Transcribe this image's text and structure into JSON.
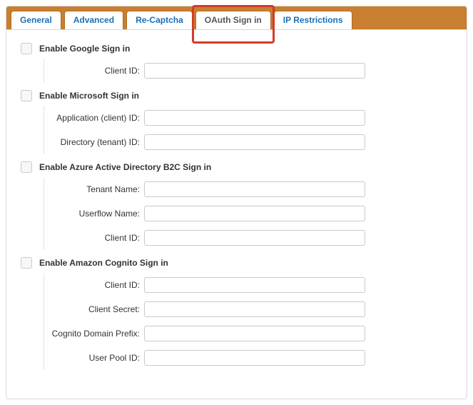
{
  "tabs": [
    {
      "label": "General",
      "active": false
    },
    {
      "label": "Advanced",
      "active": false
    },
    {
      "label": "Re-Captcha",
      "active": false
    },
    {
      "label": "OAuth Sign in",
      "active": true
    },
    {
      "label": "IP Restrictions",
      "active": false
    }
  ],
  "highlighted_tab_index": 3,
  "sections": [
    {
      "name": "google",
      "title": "Enable Google Sign in",
      "checked": false,
      "fields": [
        {
          "name": "client-id",
          "label": "Client ID:",
          "value": ""
        }
      ]
    },
    {
      "name": "microsoft",
      "title": "Enable Microsoft Sign in",
      "checked": false,
      "fields": [
        {
          "name": "application-client-id",
          "label": "Application (client) ID:",
          "value": ""
        },
        {
          "name": "directory-tenant-id",
          "label": "Directory (tenant) ID:",
          "value": ""
        }
      ]
    },
    {
      "name": "azure-b2c",
      "title": "Enable Azure Active Directory B2C Sign in",
      "checked": false,
      "fields": [
        {
          "name": "tenant-name",
          "label": "Tenant Name:",
          "value": ""
        },
        {
          "name": "userflow-name",
          "label": "Userflow Name:",
          "value": ""
        },
        {
          "name": "client-id",
          "label": "Client ID:",
          "value": ""
        }
      ]
    },
    {
      "name": "amazon-cognito",
      "title": "Enable Amazon Cognito Sign in",
      "checked": false,
      "fields": [
        {
          "name": "client-id",
          "label": "Client ID:",
          "value": ""
        },
        {
          "name": "client-secret",
          "label": "Client Secret:",
          "value": ""
        },
        {
          "name": "cognito-domain-prefix",
          "label": "Cognito Domain Prefix:",
          "value": ""
        },
        {
          "name": "user-pool-id",
          "label": "User Pool ID:",
          "value": ""
        }
      ]
    }
  ]
}
